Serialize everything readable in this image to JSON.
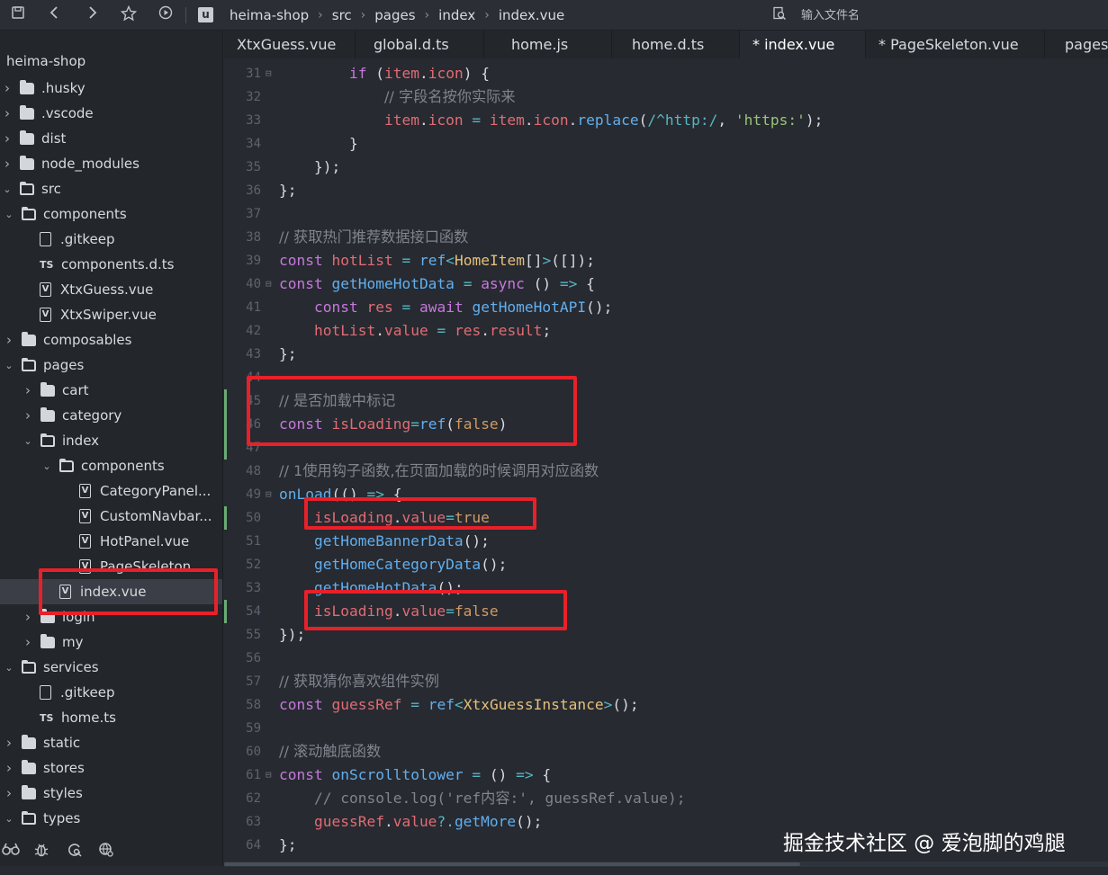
{
  "toolbar": {
    "icons": [
      "save-icon",
      "back-arrow-icon",
      "forward-arrow-icon",
      "star-icon",
      "run-icon"
    ],
    "breadcrumb": [
      "heima-shop",
      "src",
      "pages",
      "index",
      "index.vue"
    ],
    "search_placeholder": "输入文件名"
  },
  "sidebar": {
    "project": "heima-shop",
    "items": [
      {
        "label": ".husky"
      },
      {
        "label": ".vscode"
      },
      {
        "label": "dist"
      },
      {
        "label": "node_modules"
      },
      {
        "label": "src"
      },
      {
        "label": "components"
      },
      {
        "label": ".gitkeep"
      },
      {
        "label": "components.d.ts"
      },
      {
        "label": "XtxGuess.vue"
      },
      {
        "label": "XtxSwiper.vue"
      },
      {
        "label": "composables"
      },
      {
        "label": "pages"
      },
      {
        "label": "cart"
      },
      {
        "label": "category"
      },
      {
        "label": "index"
      },
      {
        "label": "components"
      },
      {
        "label": "CategoryPanel..."
      },
      {
        "label": "CustomNavbar..."
      },
      {
        "label": "HotPanel.vue"
      },
      {
        "label": "PageSkeleton..."
      },
      {
        "label": "index.vue"
      },
      {
        "label": "login"
      },
      {
        "label": "my"
      },
      {
        "label": "services"
      },
      {
        "label": ".gitkeep"
      },
      {
        "label": "home.ts"
      },
      {
        "label": "static"
      },
      {
        "label": "stores"
      },
      {
        "label": "styles"
      },
      {
        "label": "types"
      }
    ],
    "bottom_icons": [
      "binoculars-icon",
      "bug-icon",
      "refresh-search-icon",
      "settings-globe-icon"
    ]
  },
  "tabs": [
    {
      "label": "XtxGuess.vue"
    },
    {
      "label": "global.d.ts"
    },
    {
      "label": "home.js"
    },
    {
      "label": "home.d.ts"
    },
    {
      "label": "* index.vue"
    },
    {
      "label": "* PageSkeleton.vue"
    },
    {
      "label": "pages"
    }
  ],
  "editor": {
    "line_numbers": [
      "31",
      "32",
      "33",
      "34",
      "35",
      "36",
      "37",
      "38",
      "39",
      "40",
      "41",
      "42",
      "43",
      "44",
      "45",
      "46",
      "47",
      "48",
      "49",
      "50",
      "51",
      "52",
      "53",
      "54",
      "55",
      "56",
      "57",
      "58",
      "59",
      "60",
      "61",
      "62",
      "63",
      "64"
    ],
    "lines": [
      "        if (item.icon) {",
      "            // 字段名按你实际来",
      "            item.icon = item.icon.replace(/^http:/, 'https:');",
      "        }",
      "    });",
      "};",
      "",
      "// 获取热门推荐数据接口函数",
      "const hotList = ref<HomeItem[]>([]);",
      "const getHomeHotData = async () => {",
      "    const res = await getHomeHotAPI();",
      "    hotList.value = res.result;",
      "};",
      "",
      "// 是否加载中标记",
      "const isLoading=ref(false)",
      "",
      "// 1使用钩子函数,在页面加载的时候调用对应函数",
      "onLoad(() => {",
      "    isLoading.value=true",
      "    getHomeBannerData();",
      "    getHomeCategoryData();",
      "    getHomeHotData();",
      "    isLoading.value=false",
      "});",
      "",
      "// 获取猜你喜欢组件实例",
      "const guessRef = ref<XtxGuessInstance>();",
      "",
      "// 滚动触底函数",
      "const onScrolltolower = () => {",
      "    // console.log('ref内容:', guessRef.value);",
      "    guessRef.value?.getMore();",
      "};"
    ]
  },
  "watermark": "掘金技术社区 @ 爱泡脚的鸡腿",
  "colors": {
    "highlight_box": "#e8202a",
    "keyword": "#c678dd",
    "function": "#61afef",
    "variable": "#e06c75",
    "string": "#98c379",
    "comment": "#7f848e",
    "type": "#e5c07b"
  }
}
